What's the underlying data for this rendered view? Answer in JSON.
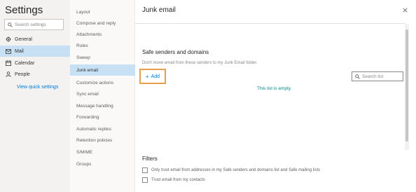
{
  "settings": {
    "title": "Settings",
    "search_placeholder": "Search settings"
  },
  "nav": {
    "items": [
      {
        "label": "General",
        "icon": "gear-icon"
      },
      {
        "label": "Mail",
        "icon": "mail-icon",
        "selected": true
      },
      {
        "label": "Calendar",
        "icon": "calendar-icon"
      },
      {
        "label": "People",
        "icon": "people-icon"
      }
    ],
    "view_quick_settings": "View quick settings"
  },
  "submenu": {
    "items": [
      "Layout",
      "Compose and reply",
      "Attachments",
      "Rules",
      "Sweep",
      "Junk email",
      "Customize actions",
      "Sync email",
      "Message handling",
      "Forwarding",
      "Automatic replies",
      "Retention policies",
      "S/MIME",
      "Groups"
    ],
    "selected_index": 5
  },
  "pane": {
    "title": "Junk email",
    "close_icon": "close-icon"
  },
  "safe_senders": {
    "title": "Safe senders and domains",
    "description": "Don't move email from these senders to my Junk Email folder.",
    "add_label": "Add",
    "search_placeholder": "Search list",
    "empty_message": "This list is empty."
  },
  "filters": {
    "title": "Filters",
    "options": [
      {
        "label": "Only trust email from addresses in my Safe senders and domains list and Safe mailing lists",
        "checked": false
      },
      {
        "label": "Trust email from my contacts",
        "checked": false
      }
    ]
  },
  "colors": {
    "accent": "#0078d4",
    "selected_bg": "#c7e0f4",
    "highlight_border": "#e6a04d",
    "empty_text": "#038387"
  }
}
